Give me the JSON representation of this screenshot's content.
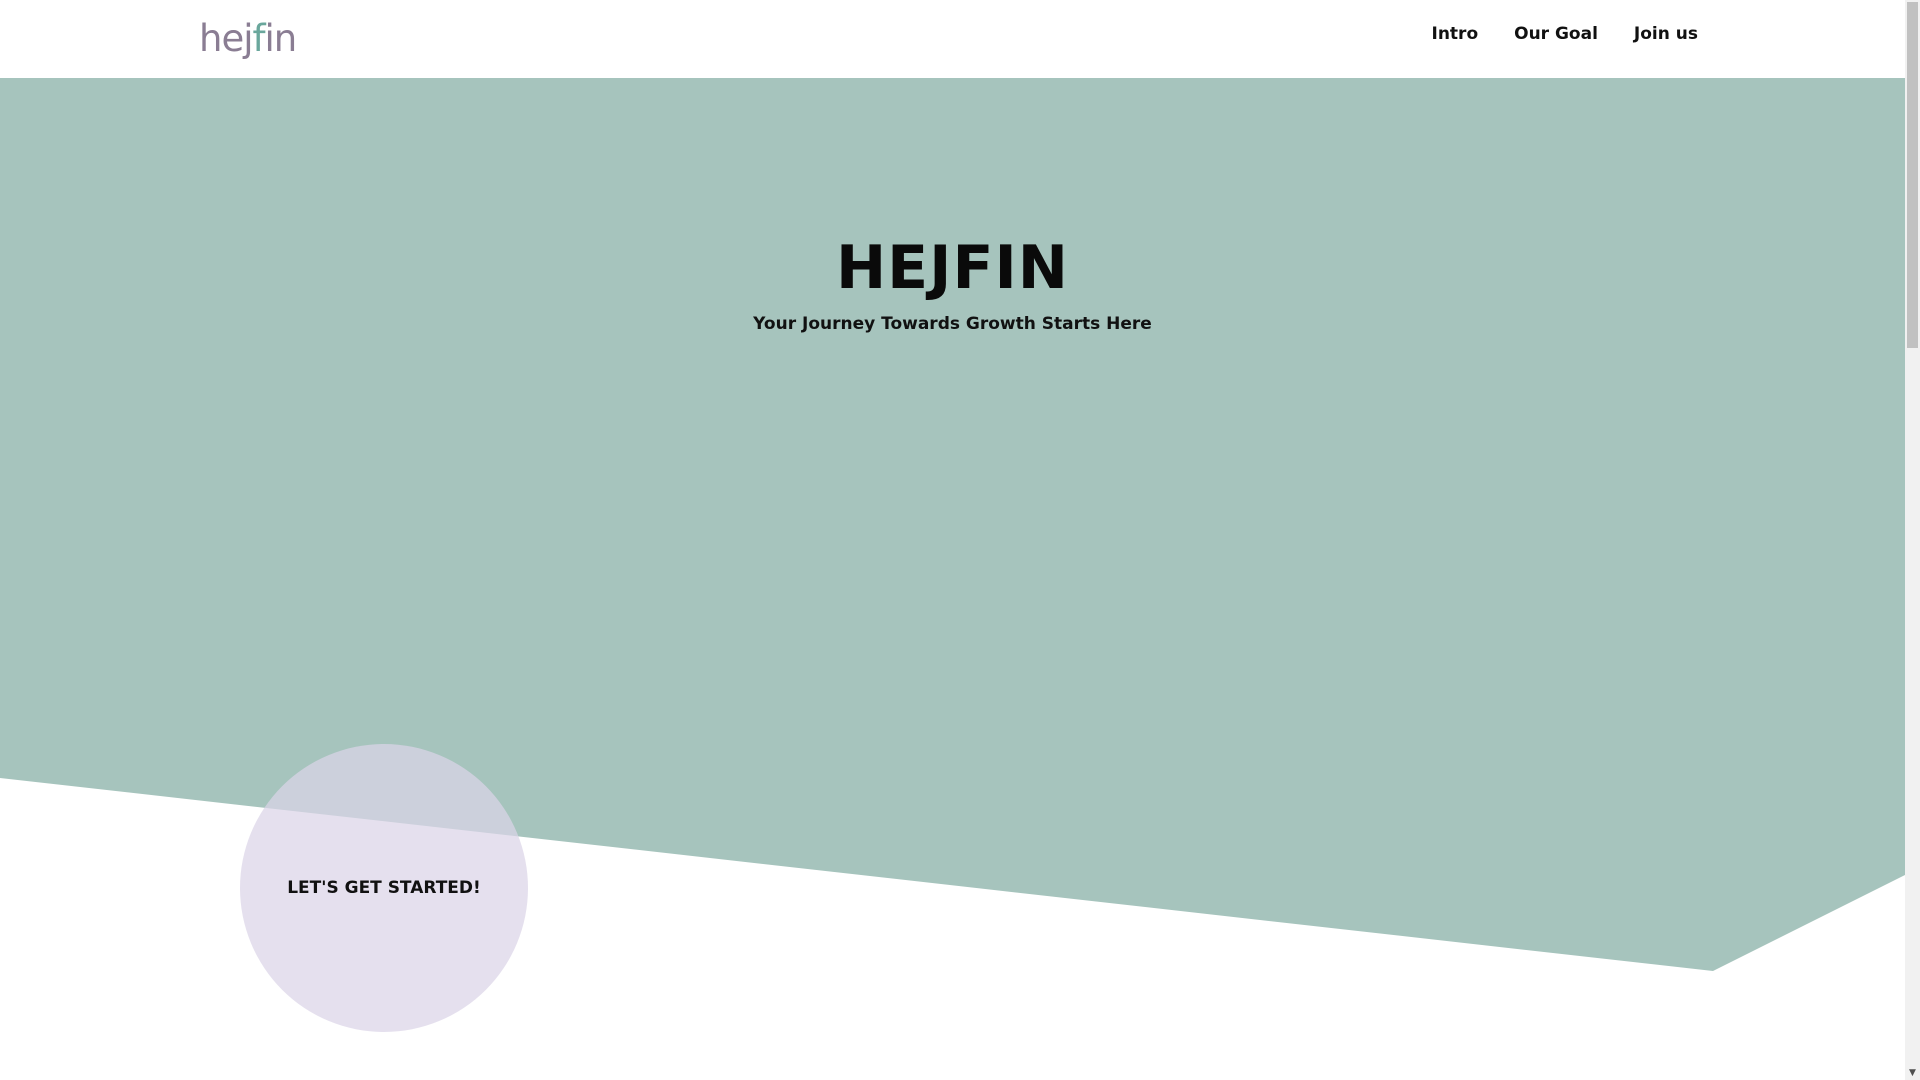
{
  "header": {
    "logo": {
      "part1": "hej",
      "part2": "f",
      "part3": "in"
    },
    "nav": [
      {
        "label": "Intro"
      },
      {
        "label": "Our Goal"
      },
      {
        "label": "Join us"
      }
    ]
  },
  "hero": {
    "title": "HEJFIN",
    "subtitle": "Your Journey Towards Growth Starts Here",
    "cta_label": "LET'S GET STARTED!"
  },
  "colors": {
    "hero_bg": "#a6c4bd",
    "circle": "#ddd6e8",
    "logo_main": "#8a7d93",
    "logo_accent": "#6aa79c"
  },
  "icons": {
    "scroll_down": "chevron-down-icon"
  }
}
